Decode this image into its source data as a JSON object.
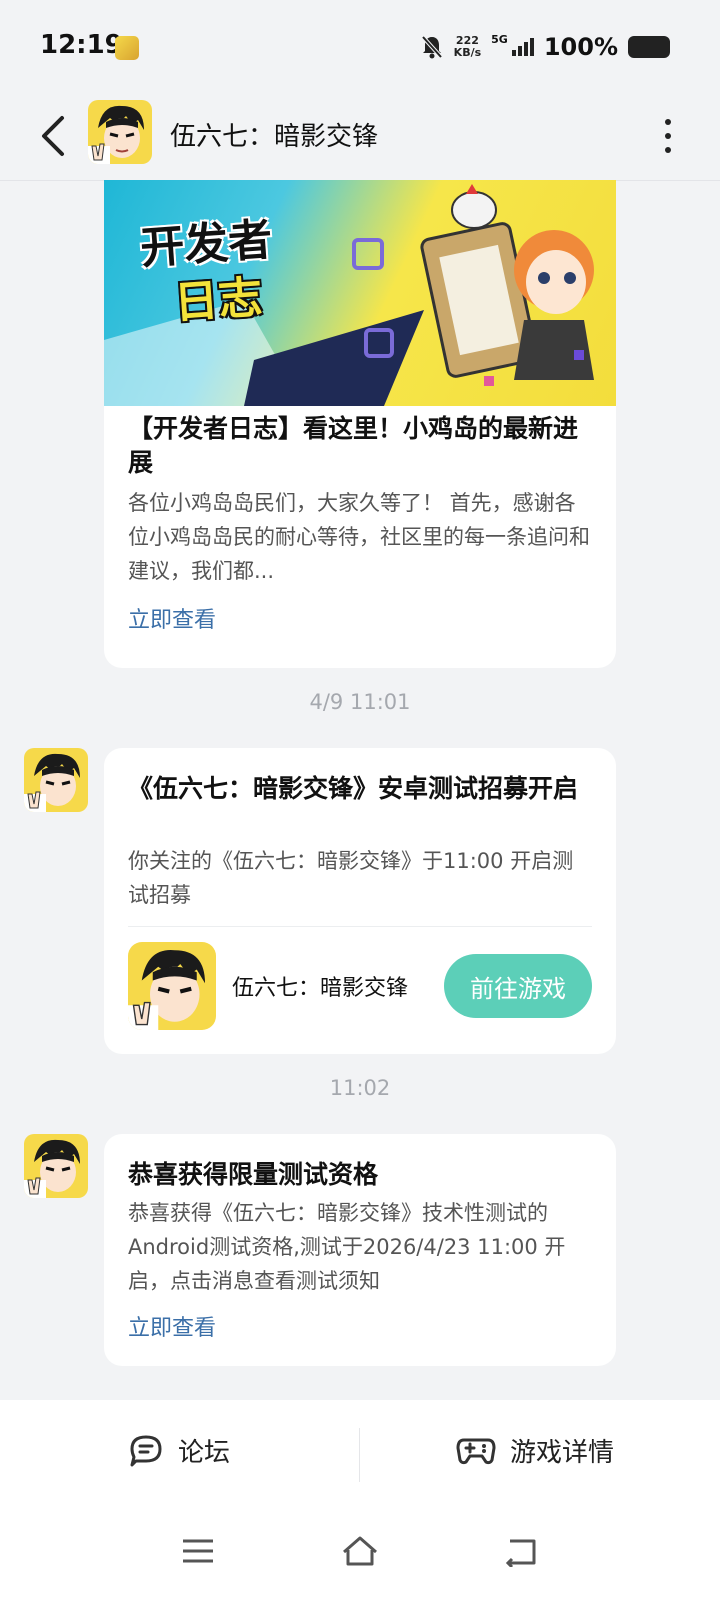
{
  "status_bar": {
    "time": "12:19",
    "net_speed_value": "222",
    "net_speed_unit": "KB/s",
    "network_type": "5G",
    "battery_percent": "100%"
  },
  "header": {
    "title": "伍六七：暗影交锋",
    "back_icon": "chevron-left-icon",
    "more_icon": "more-vertical-icon"
  },
  "messages": {
    "dev_log": {
      "banner_text_line1": "开发者",
      "banner_text_line2": "日志",
      "title": "【开发者日志】看这里！小鸡岛的最新进展",
      "body": "各位小鸡岛岛民们，大家久等了！ 首先，感谢各位小鸡岛岛民的耐心等待，社区里的每一条追问和建议，我们都...",
      "link": "立即查看"
    },
    "recruit": {
      "timestamp": "4/9  11:01",
      "title": "《伍六七：暗影交锋》安卓测试招募开启",
      "body": "你关注的《伍六七：暗影交锋》于11:00 开启测试招募",
      "game_name": "伍六七：暗影交锋",
      "button": "前往游戏"
    },
    "qualification": {
      "timestamp": "11:02",
      "title": "恭喜获得限量测试资格",
      "body": "恭喜获得《伍六七：暗影交锋》技术性测试的Android测试资格,测试于2026/4/23 11:00 开启，点击消息查看测试须知",
      "link": "立即查看"
    }
  },
  "bottom_bar": {
    "forum_label": "论坛",
    "game_detail_label": "游戏详情"
  },
  "colors": {
    "link": "#3b6fa8",
    "accent_button": "#5ccfb8",
    "background": "#f2f3f5"
  }
}
